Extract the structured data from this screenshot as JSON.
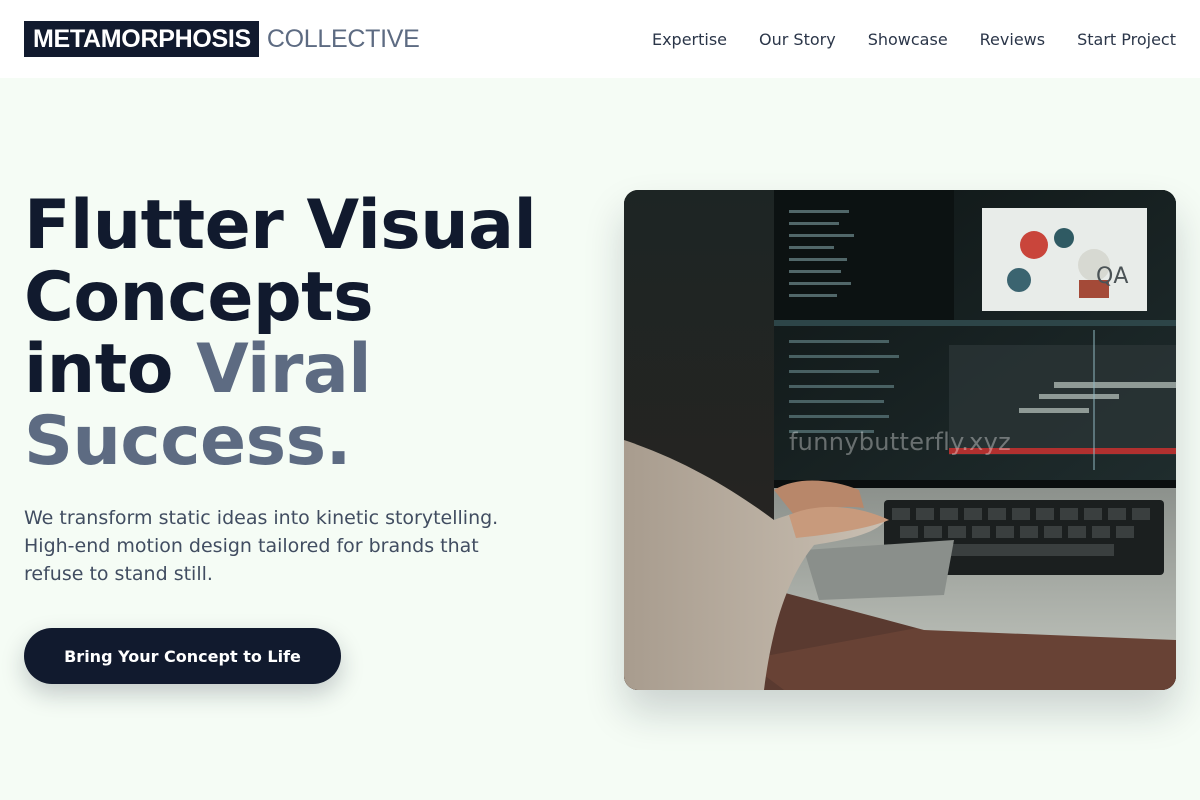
{
  "header": {
    "logo_primary": "METAMORPHOSIS",
    "logo_secondary": "COLLECTIVE",
    "nav": [
      {
        "label": "Expertise"
      },
      {
        "label": "Our Story"
      },
      {
        "label": "Showcase"
      },
      {
        "label": "Reviews"
      },
      {
        "label": "Start Project"
      }
    ]
  },
  "hero": {
    "headline_line1": "Flutter Visual",
    "headline_line2": "Concepts",
    "headline_line3_plain": "into ",
    "headline_line3_accent": "Viral",
    "headline_line4_accent": "Success.",
    "subtext": "We transform static ideas into kinetic storytelling. High-end motion design tailored for brands that refuse to stand still.",
    "cta_label": "Bring Your Concept to Life",
    "image": {
      "watermark": "funnybutterfly.xyz",
      "screen_label": "QA"
    }
  },
  "colors": {
    "primary": "#111a2e",
    "accent_text": "#5d6b82",
    "page_bg": "#f5fcf5",
    "header_bg": "#ffffff"
  }
}
